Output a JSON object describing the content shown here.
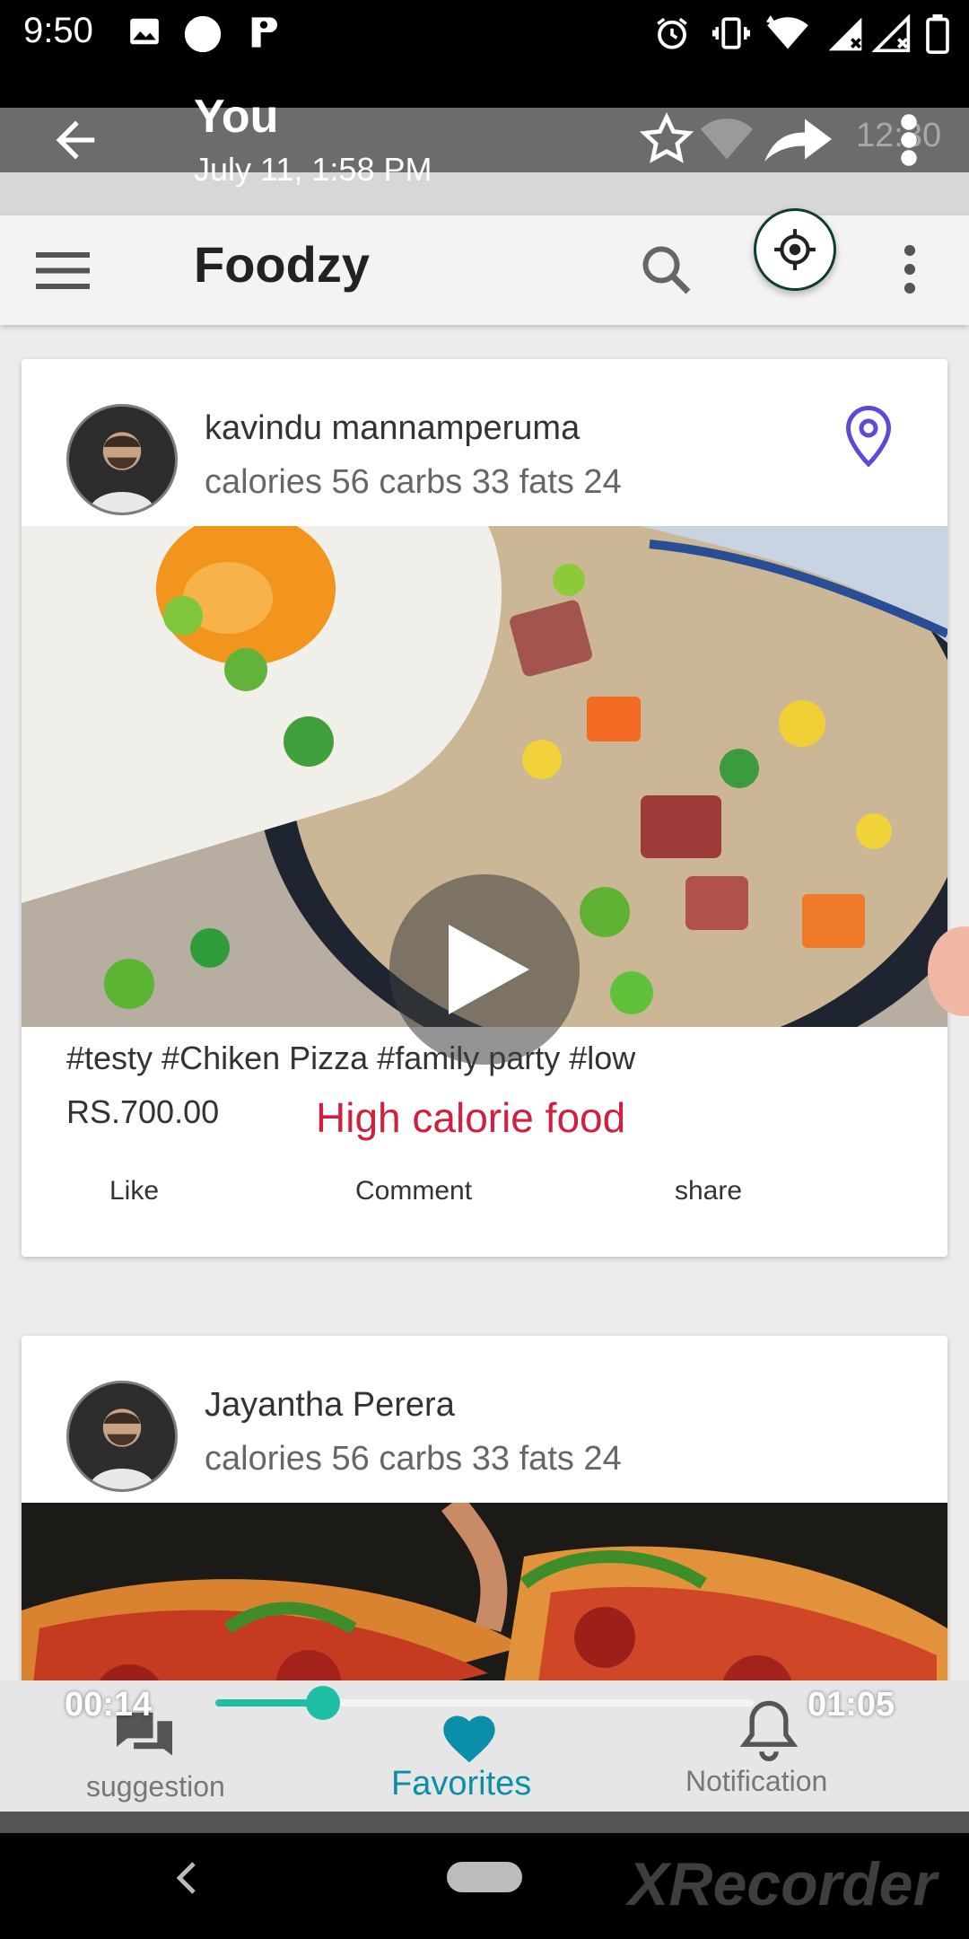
{
  "status_bar": {
    "time": "9:50"
  },
  "video_header": {
    "title": "You",
    "subtitle": "July 11, 1:58 PM",
    "network_text": "12:30"
  },
  "app_bar": {
    "title": "Foodzy"
  },
  "posts": [
    {
      "user": "kavindu mannamperuma",
      "nutrition": "calories 56 carbs 33 fats 24",
      "tags": "#testy #Chiken Pizza #family party #low",
      "price": "RS.700.00",
      "calorie_label": "High calorie food",
      "actions": {
        "like": "Like",
        "comment": "Comment",
        "share": "share"
      }
    },
    {
      "user": "Jayantha Perera",
      "nutrition": "calories 56 carbs 33 fats 24"
    }
  ],
  "bottom_nav": {
    "suggestion": "suggestion",
    "favorites": "Favorites",
    "notification": "Notification"
  },
  "video_controls": {
    "current_time": "00:14",
    "total_time": "01:05",
    "progress": 0.2
  },
  "watermark": "XRecorder",
  "colors": {
    "accent": "#1fbfa6",
    "favorite": "#0b8fa8",
    "high_calorie": "#d0203f",
    "location_pin": "#5b4bd6"
  }
}
